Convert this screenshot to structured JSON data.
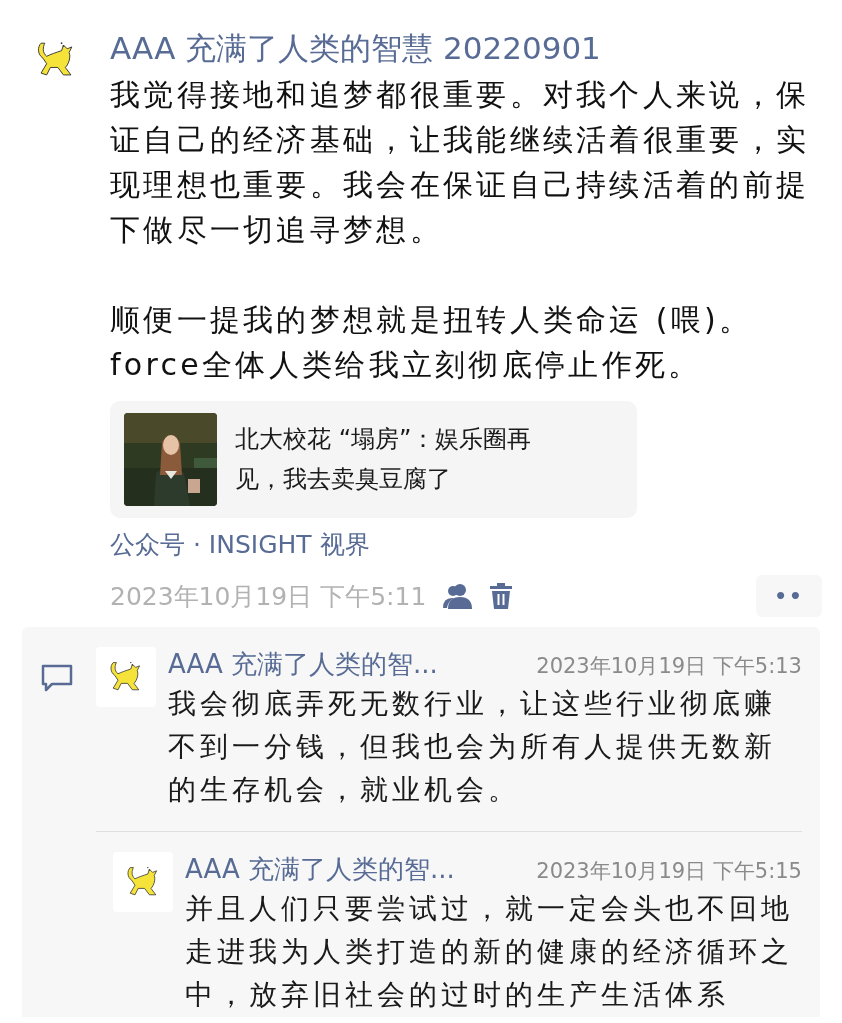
{
  "post": {
    "author": "AAA 充满了人类的智慧 20220901",
    "paragraphs": [
      [
        "我觉得接地和追梦都很重要。对我个人来说，保证自己的经济基础，让我能继续活着很重要，实现理想也重要。我会在保证自己持续活着的前提下做尽一切追寻梦想。"
      ],
      [
        "顺便一提我的梦想就是扭转人类命运 (喂)。",
        "force全体人类给我立刻彻底停止作死。"
      ]
    ],
    "link_card": {
      "title": "北大校花 “塌房”：娱乐圈再见，我去卖臭豆腐了"
    },
    "source": "公众号 · INSIGHT 视界",
    "time": "2023年10月19日 下午5:11",
    "more_button": "••"
  },
  "comments": [
    {
      "author": "AAA 充满了人类的智...",
      "time": "2023年10月19日 下午5:13",
      "text": "我会彻底弄死无数行业，让这些行业彻底赚不到一分钱，但我也会为所有人提供无数新的生存机会，就业机会。"
    },
    {
      "author": "AAA 充满了人类的智...",
      "time": "2023年10月19日 下午5:15",
      "text": "并且人们只要尝试过，就一定会头也不回地走进我为人类打造的新的健康的经济循环之中，放弃旧社会的过时的生产生活体系"
    }
  ]
}
